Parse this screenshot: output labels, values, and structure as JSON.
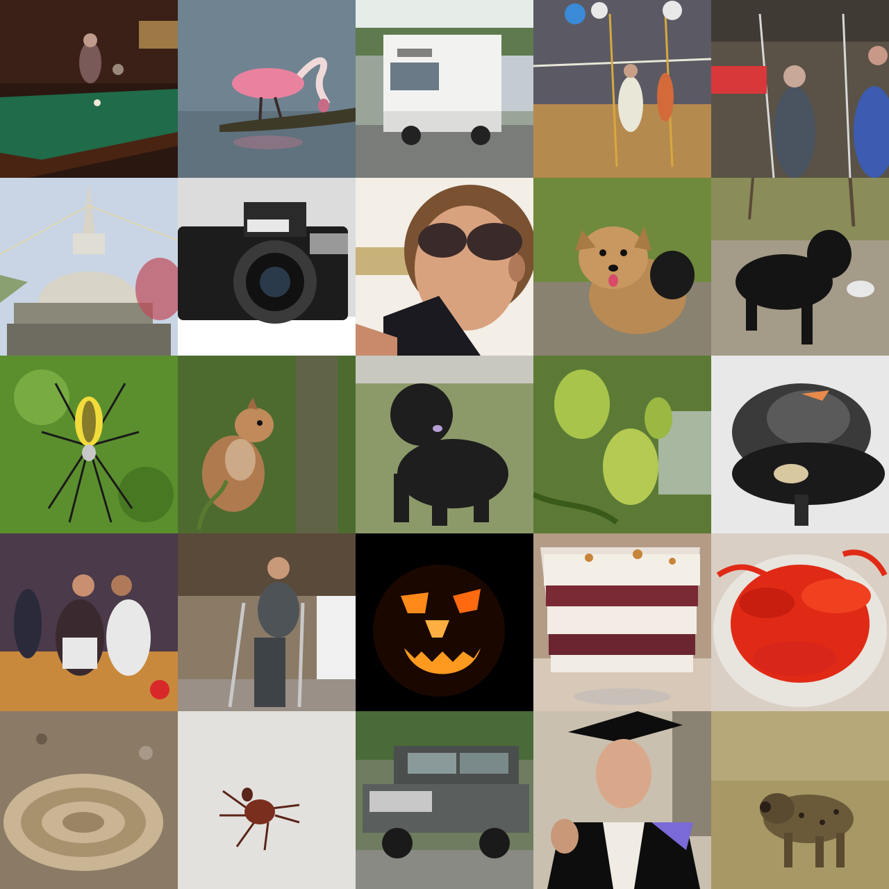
{
  "grid": {
    "rows": 5,
    "columns": 5,
    "tiles": [
      {
        "subject": "billiards-table",
        "colors": {
          "bg": "#2a1710",
          "accent": "#1f6b4a"
        }
      },
      {
        "subject": "spoonbill",
        "colors": {
          "bg": "#6f8391",
          "accent": "#e9829f"
        }
      },
      {
        "subject": "box-truck",
        "colors": {
          "bg": "#9aa59a",
          "accent": "#f2f2f0"
        }
      },
      {
        "subject": "volleyball-gym",
        "colors": {
          "bg": "#b58a4e",
          "accent": "#e9e7d8"
        }
      },
      {
        "subject": "people-carousel",
        "colors": {
          "bg": "#5a5247",
          "accent": "#3b5cb0"
        }
      },
      {
        "subject": "stupa",
        "colors": {
          "bg": "#c9d5e4",
          "accent": "#d9d4c8"
        }
      },
      {
        "subject": "camera",
        "colors": {
          "bg": "#dcdcdc",
          "accent": "#1c1c1c"
        }
      },
      {
        "subject": "child-sunglasses",
        "colors": {
          "bg": "#f3eee6",
          "accent": "#d9a27f"
        }
      },
      {
        "subject": "terrier-dog",
        "colors": {
          "bg": "#6f8a3c",
          "accent": "#b98a54"
        }
      },
      {
        "subject": "black-spaniel",
        "colors": {
          "bg": "#a49b88",
          "accent": "#141414"
        }
      },
      {
        "subject": "garden-spider",
        "colors": {
          "bg": "#5b8f2e",
          "accent": "#f2dc3b"
        }
      },
      {
        "subject": "squirrel",
        "colors": {
          "bg": "#4d6b2f",
          "accent": "#b07a4f"
        }
      },
      {
        "subject": "kerry-blue-terrier",
        "colors": {
          "bg": "#8c9a6a",
          "accent": "#1e1e1e"
        }
      },
      {
        "subject": "jackfruit",
        "colors": {
          "bg": "#5c7a36",
          "accent": "#a8c44a"
        }
      },
      {
        "subject": "steam-appliance",
        "colors": {
          "bg": "#e8e8e8",
          "accent": "#3a3a3a"
        }
      },
      {
        "subject": "basketball-game",
        "colors": {
          "bg": "#4a3a4a",
          "accent": "#c8893c"
        }
      },
      {
        "subject": "man-crutches",
        "colors": {
          "bg": "#8a7a66",
          "accent": "#4e5358"
        }
      },
      {
        "subject": "jack-o-lantern",
        "colors": {
          "bg": "#000000",
          "accent": "#ff8a1a"
        }
      },
      {
        "subject": "trifle-dessert",
        "colors": {
          "bg": "#b39b86",
          "accent": "#7a2a35"
        }
      },
      {
        "subject": "lobsters",
        "colors": {
          "bg": "#d9cfc4",
          "accent": "#e02a16"
        }
      },
      {
        "subject": "rattlesnake",
        "colors": {
          "bg": "#8b7a66",
          "accent": "#c9b493"
        }
      },
      {
        "subject": "tick",
        "colors": {
          "bg": "#dedcd8",
          "accent": "#7a2e1e"
        }
      },
      {
        "subject": "land-rover",
        "colors": {
          "bg": "#6e7c5f",
          "accent": "#5a5f5d"
        }
      },
      {
        "subject": "graduate",
        "colors": {
          "bg": "#c9c0b0",
          "accent": "#0d0d0d"
        }
      },
      {
        "subject": "hyena",
        "colors": {
          "bg": "#a89865",
          "accent": "#6b5a3a"
        }
      }
    ]
  }
}
